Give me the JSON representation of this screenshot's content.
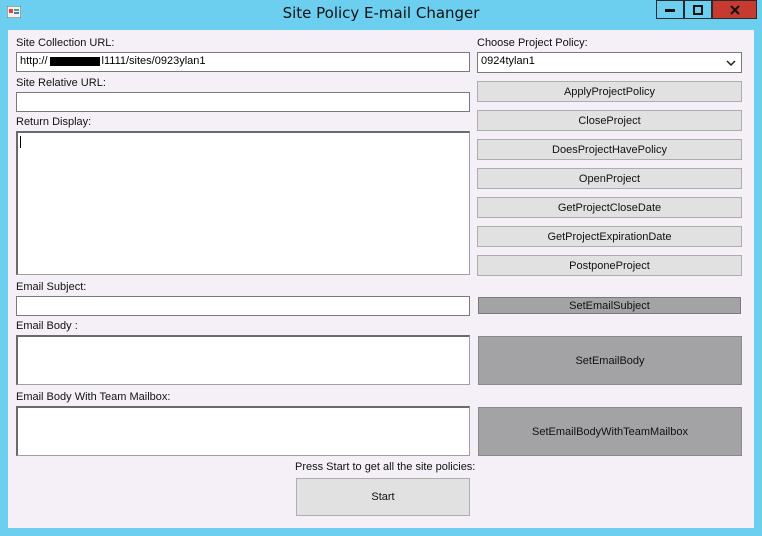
{
  "window": {
    "title": "Site Policy E-mail Changer",
    "icon": "app-window-icon"
  },
  "form": {
    "site_collection_label": "Site Collection URL:",
    "site_collection_value_prefix": "http://",
    "site_collection_value_suffix": "l1111/sites/0923ylan1",
    "site_relative_label": "Site Relative URL:",
    "site_relative_value": "",
    "return_display_label": "Return Display:",
    "email_subject_label": "Email Subject:",
    "email_body_label": "Email Body :",
    "email_body_team_label": "Email Body With Team Mailbox:",
    "choose_policy_label": "Choose Project Policy:",
    "choose_policy_value": "0924tylan1",
    "start_prompt": "Press Start to get all the site policies:",
    "start_label": "Start"
  },
  "actions": [
    "ApplyProjectPolicy",
    "CloseProject",
    "DoesProjectHavePolicy",
    "OpenProject",
    "GetProjectCloseDate",
    "GetProjectExpirationDate",
    "PostponeProject"
  ],
  "email_actions": {
    "subject": "SetEmailSubject",
    "body": "SetEmailBody",
    "body_team": "SetEmailBodyWithTeamMailbox"
  },
  "colors": {
    "titlebar": "#6ccff0",
    "close_button": "#c73a30",
    "client_bg": "#f5f0f7"
  }
}
